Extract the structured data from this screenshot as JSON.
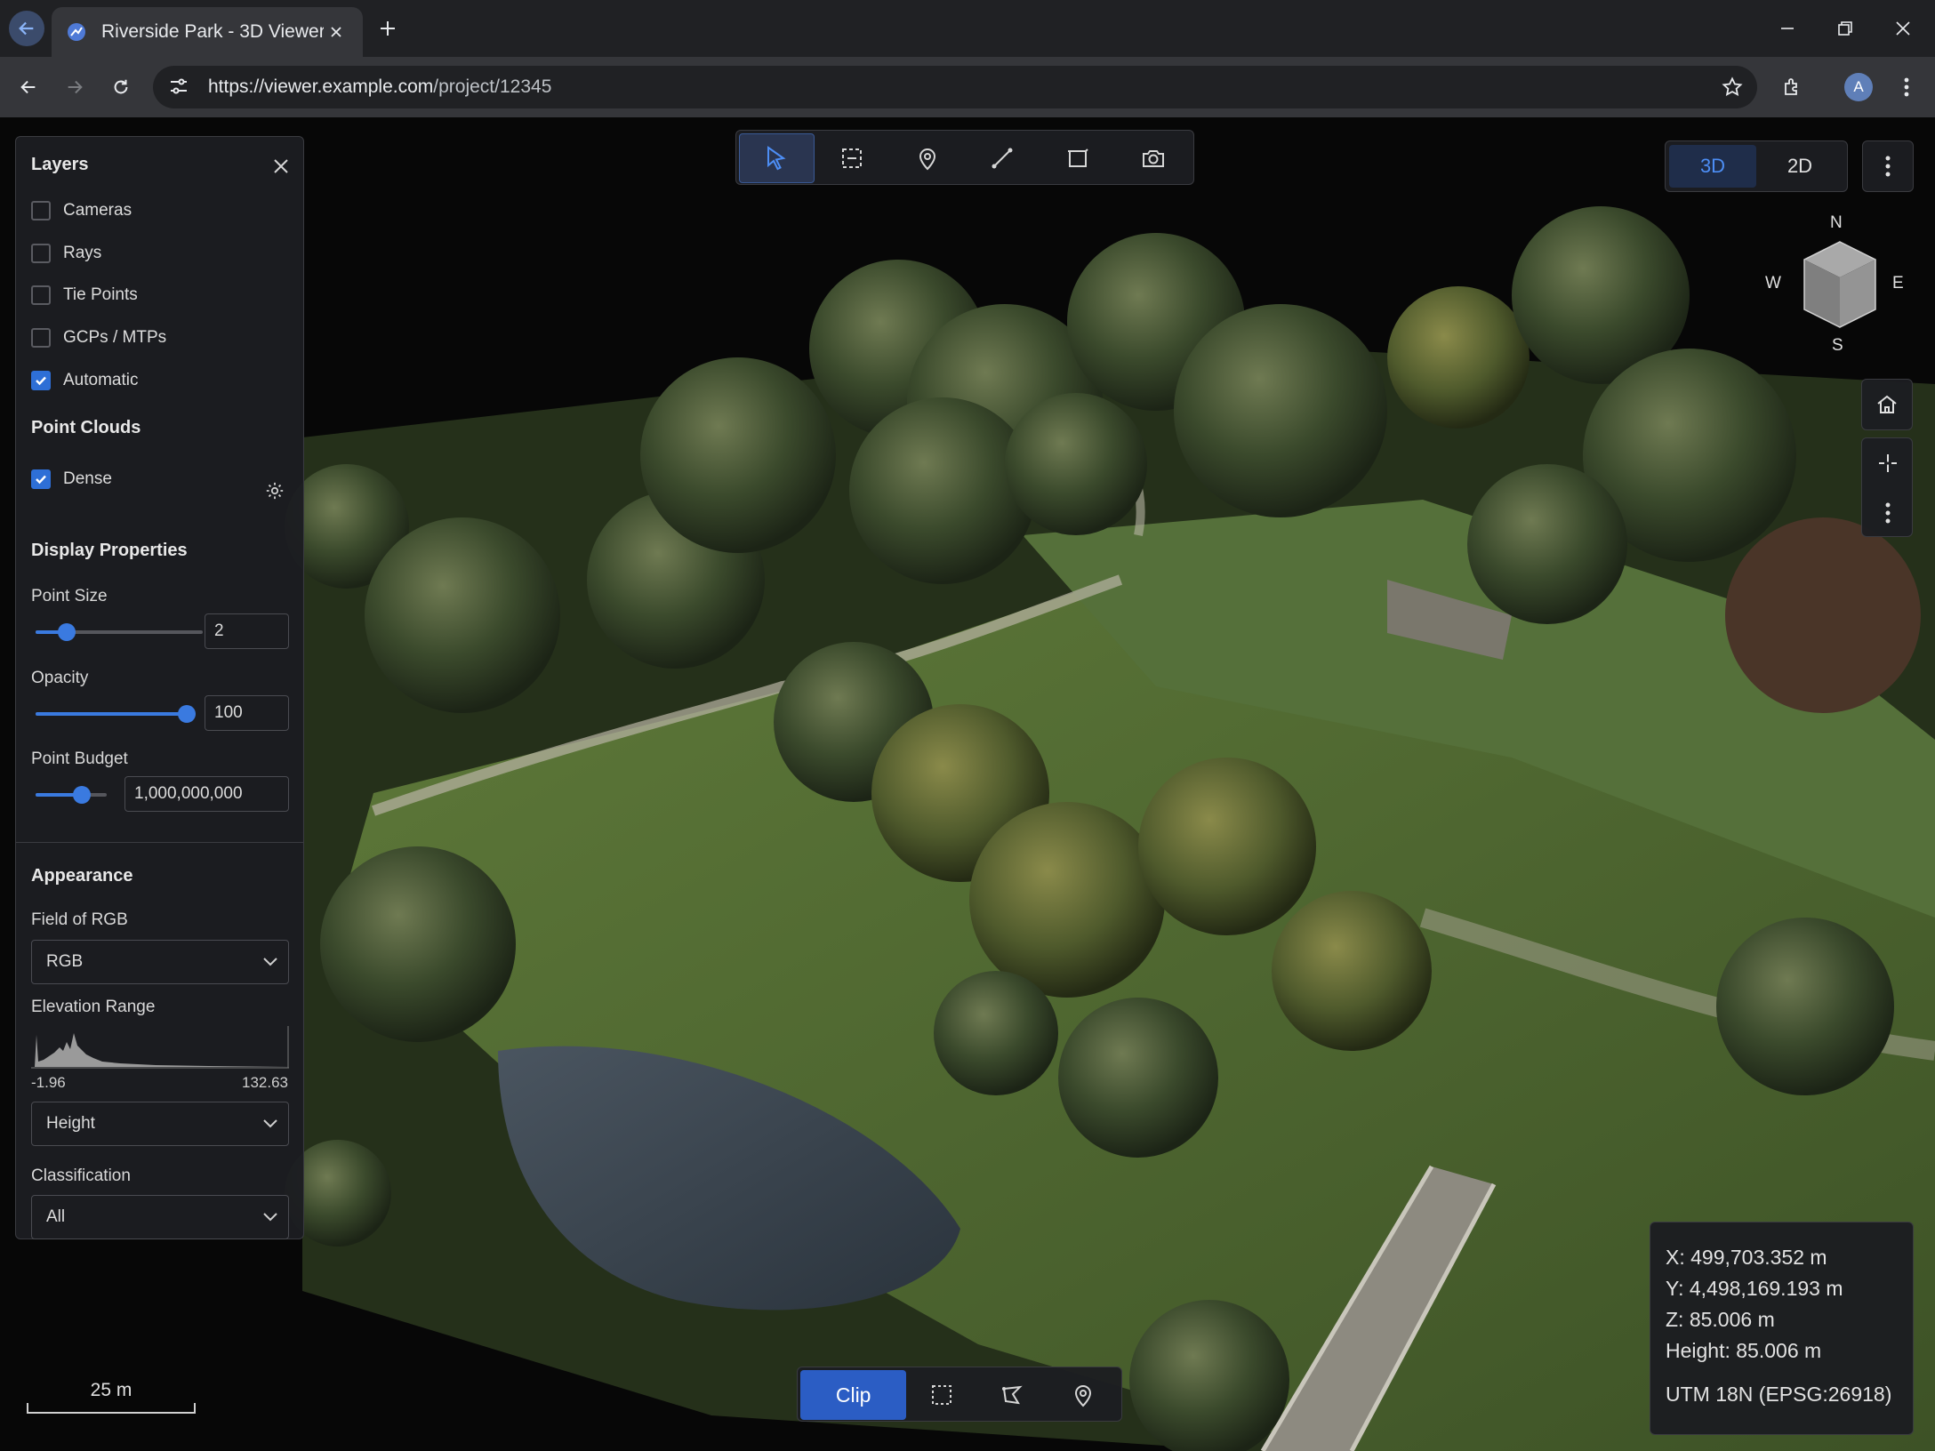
{
  "browser": {
    "tab_title": "Riverside Park - 3D Viewer",
    "url_host": "https://viewer.example.com",
    "url_path": "/project/12345",
    "avatar_letter": "A"
  },
  "layers": {
    "title": "Layers",
    "items": [
      {
        "label": "Cameras",
        "checked": false
      },
      {
        "label": "Rays",
        "checked": false
      },
      {
        "label": "Tie Points",
        "checked": false
      },
      {
        "label": "GCPs / MTPs",
        "checked": false
      },
      {
        "label": "Automatic",
        "checked": true
      }
    ],
    "point_clouds_title": "Point Clouds",
    "dense": {
      "label": "Dense",
      "checked": true
    },
    "display_properties_title": "Display Properties",
    "point_size": {
      "label": "Point Size",
      "value": "2",
      "slider_fraction": 0.15
    },
    "opacity": {
      "label": "Opacity",
      "value": "100",
      "slider_fraction": 1.0
    },
    "point_budget": {
      "label": "Point Budget",
      "value": "1,000,000,000",
      "slider_fraction": 0.7
    },
    "appearance_title": "Appearance",
    "field_of_rgb": {
      "label": "Field of RGB",
      "value": "RGB"
    },
    "elevation_range": {
      "label": "Elevation Range",
      "min": "-1.96",
      "max": "132.63"
    },
    "elevation_mode": {
      "value": "Height"
    },
    "classification": {
      "label": "Classification",
      "value": "All"
    }
  },
  "view_toggle": {
    "mode_3d": "3D",
    "mode_2d": "2D",
    "active": "3D"
  },
  "compass": {
    "n": "N",
    "s": "S",
    "e": "E",
    "w": "W"
  },
  "coords": {
    "x": "X: 499,703.352 m",
    "y": "Y: 4,498,169.193 m",
    "z": "Z: 85.006 m",
    "height": "Height: 85.006 m",
    "projection": "UTM 18N (EPSG:26918)"
  },
  "bottom_tools": {
    "clip_label": "Clip"
  },
  "scale": {
    "label": "25 m"
  },
  "colors": {
    "accent": "#2e6fd6",
    "panel_bg": "#1c1d21",
    "chrome_bg": "#202124"
  }
}
